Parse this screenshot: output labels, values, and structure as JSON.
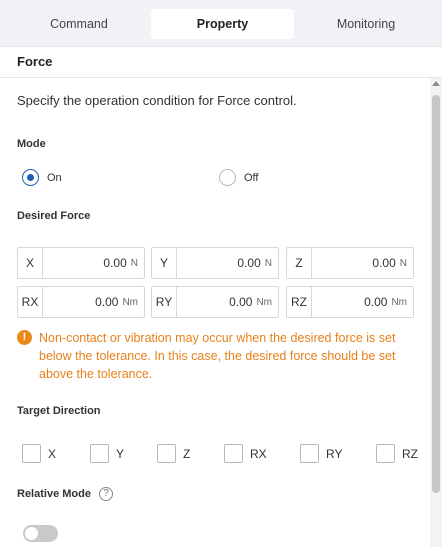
{
  "tabs": [
    {
      "label": "Command",
      "active": false
    },
    {
      "label": "Property",
      "active": true
    },
    {
      "label": "Monitoring",
      "active": false
    }
  ],
  "panel": {
    "title": "Force",
    "description": "Specify the operation condition for Force control."
  },
  "mode": {
    "label": "Mode",
    "options": [
      {
        "label": "On",
        "selected": true
      },
      {
        "label": "Off",
        "selected": false
      }
    ]
  },
  "desired_force": {
    "label": "Desired Force",
    "fields": [
      {
        "axis": "X",
        "value": "0.00",
        "unit": "N"
      },
      {
        "axis": "Y",
        "value": "0.00",
        "unit": "N"
      },
      {
        "axis": "Z",
        "value": "0.00",
        "unit": "N"
      },
      {
        "axis": "RX",
        "value": "0.00",
        "unit": "Nm"
      },
      {
        "axis": "RY",
        "value": "0.00",
        "unit": "Nm"
      },
      {
        "axis": "RZ",
        "value": "0.00",
        "unit": "Nm"
      }
    ]
  },
  "warning": {
    "icon": "warning-icon",
    "text": "Non-contact or vibration may occur when the desired force is set below the tolerance. In this case, the desired force should be set above the tolerance."
  },
  "target_direction": {
    "label": "Target Direction",
    "options": [
      {
        "label": "X",
        "checked": false
      },
      {
        "label": "Y",
        "checked": false
      },
      {
        "label": "Z",
        "checked": false
      },
      {
        "label": "RX",
        "checked": false
      },
      {
        "label": "RY",
        "checked": false
      },
      {
        "label": "RZ",
        "checked": false
      }
    ]
  },
  "relative_mode": {
    "label": "Relative Mode",
    "help_icon": "help-icon",
    "enabled": false
  },
  "colors": {
    "accent": "#1d5fb8",
    "warning": "#e8811a"
  }
}
